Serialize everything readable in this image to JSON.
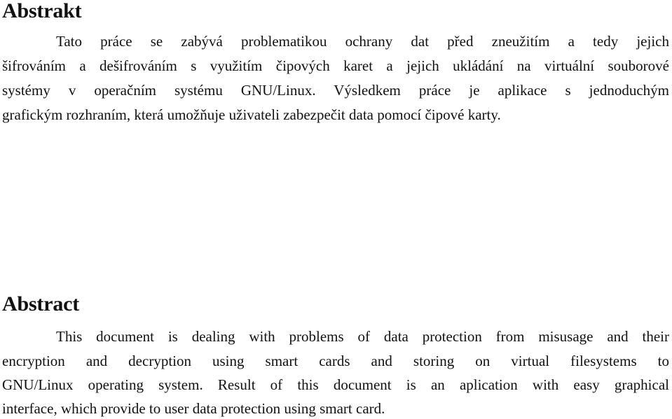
{
  "sections": [
    {
      "heading": "Abstrakt",
      "lines": [
        "Tato práce se zabývá problematikou ochrany dat před zneužitím a tedy jejich",
        "šifrováním a dešifrováním s využitím čipových karet a jejich ukládání na virtuální souborové",
        "systémy v operačním systému GNU/Linux. Výsledkem práce je aplikace s jednoduchým",
        "grafickým rozhraním, která umožňuje uživateli zabezpečit data pomocí čipové karty."
      ]
    },
    {
      "heading": "Abstract",
      "lines": [
        "This document is dealing with problems of data protection from misusage and their",
        "encryption and decryption using smart cards and storing on virtual filesystems to",
        "GNU/Linux operating system. Result of this document is an aplication with easy graphical",
        "interface, which provide to user data protection using smart card."
      ]
    }
  ]
}
